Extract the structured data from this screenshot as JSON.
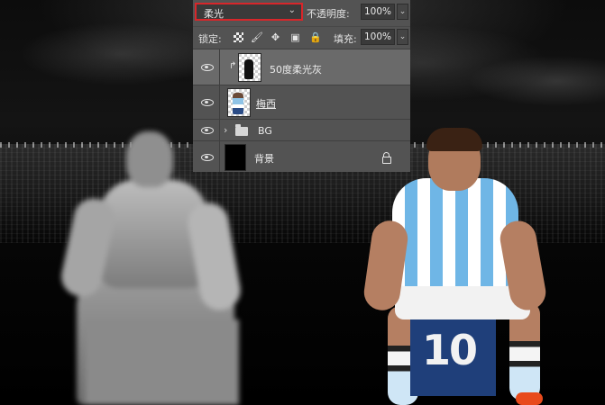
{
  "toolbar": {
    "blend_mode": "柔光",
    "opacity_label": "不透明度:",
    "opacity_value": "100%",
    "lock_label": "锁定:",
    "fill_label": "填充:",
    "fill_value": "100%"
  },
  "layers": [
    {
      "name": "50度柔光灰",
      "selected": true,
      "thumbnail": "masked-figure-gray",
      "clipped": true
    },
    {
      "name": "梅西",
      "selected": false,
      "thumbnail": "player-photo"
    },
    {
      "name": "BG",
      "selected": false,
      "thumbnail": "folder-icon",
      "group": true
    },
    {
      "name": "背景",
      "selected": false,
      "thumbnail": "black-fill",
      "locked": true
    }
  ],
  "canvas": {
    "jersey_number": "10"
  },
  "colors": {
    "panel_bg": "#535353",
    "selected_row": "#6a6a6a",
    "highlight_border": "#d8262a"
  }
}
